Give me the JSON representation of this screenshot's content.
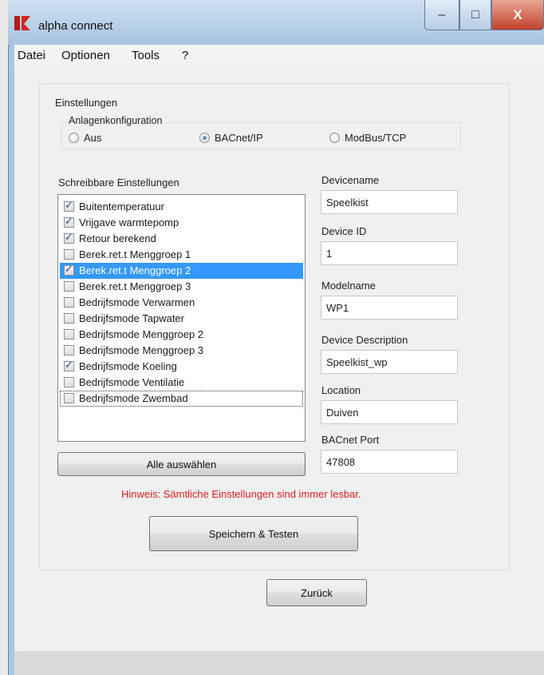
{
  "window": {
    "title": "alpha connect",
    "minimize": "–",
    "maximize": "□",
    "close": "X"
  },
  "menu": [
    "Datei",
    "Optionen",
    "Tools",
    "?"
  ],
  "settings_group": {
    "label": "Einstellungen"
  },
  "config": {
    "label": "Anlagenkonfiguration",
    "options": [
      {
        "label": "Aus",
        "checked": false
      },
      {
        "label": "BACnet/IP",
        "checked": true
      },
      {
        "label": "ModBus/TCP",
        "checked": false
      }
    ]
  },
  "writable": {
    "label": "Schreibbare Einstellungen",
    "items": [
      {
        "label": "Buitentemperatuur",
        "checked": true
      },
      {
        "label": "Vrijgave warmtepomp",
        "checked": true
      },
      {
        "label": "Retour berekend",
        "checked": true
      },
      {
        "label": "Berek.ret.t Menggroep 1",
        "checked": false
      },
      {
        "label": "Berek.ret.t Menggroep 2",
        "checked": true,
        "selected": true
      },
      {
        "label": "Berek.ret.t Menggroep 3",
        "checked": false
      },
      {
        "label": "Bedrijfsmode Verwarmen",
        "checked": false
      },
      {
        "label": "Bedrijfsmode Tapwater",
        "checked": false
      },
      {
        "label": "Bedrijfsmode Menggroep 2",
        "checked": false
      },
      {
        "label": "Bedrijfsmode Menggroep 3",
        "checked": false
      },
      {
        "label": "Bedrijfsmode Koeling",
        "checked": true
      },
      {
        "label": "Bedrijfsmode Ventilatie",
        "checked": false
      },
      {
        "label": "Bedrijfsmode Zwembad",
        "checked": false,
        "focused": true
      }
    ],
    "select_all": "Alle auswählen"
  },
  "fields": {
    "devicename": {
      "label": "Devicename",
      "value": "Speelkist"
    },
    "device_id": {
      "label": "Device ID",
      "value": "1"
    },
    "modelname": {
      "label": "Modelname",
      "value": "WP1"
    },
    "description": {
      "label": "Device Description",
      "value": "Speelkist_wp"
    },
    "location": {
      "label": "Location",
      "value": "Duiven"
    },
    "port": {
      "label": "BACnet Port",
      "value": "47808"
    }
  },
  "hint": "Hinweis: Sämtliche Einstellungen sind immer lesbar.",
  "buttons": {
    "save_test": "Speichern & Testen",
    "back": "Zurück"
  },
  "colors": {
    "hint": "#d42121",
    "selection": "#3399ff",
    "titlebar": "#a9c7e3"
  }
}
